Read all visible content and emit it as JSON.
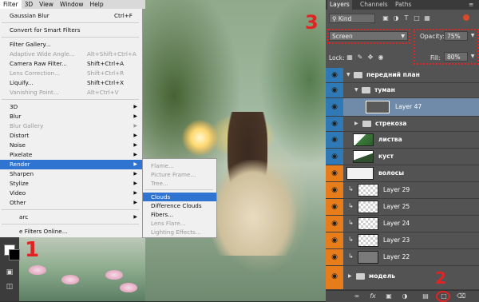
{
  "menubar": {
    "items": [
      "Filter",
      "3D",
      "View",
      "Window",
      "Help"
    ]
  },
  "filter_menu": {
    "last_filter": {
      "label": "Gaussian Blur",
      "shortcut": "Ctrl+F"
    },
    "convert": "Convert for Smart Filters",
    "special": [
      {
        "label": "Filter Gallery...",
        "shortcut": "",
        "disabled": false
      },
      {
        "label": "Adaptive Wide Angle...",
        "shortcut": "Alt+Shift+Ctrl+A",
        "disabled": true
      },
      {
        "label": "Camera Raw Filter...",
        "shortcut": "Shift+Ctrl+A",
        "disabled": false
      },
      {
        "label": "Lens Correction...",
        "shortcut": "Shift+Ctrl+R",
        "disabled": true
      },
      {
        "label": "Liquify...",
        "shortcut": "Shift+Ctrl+X",
        "disabled": false
      },
      {
        "label": "Vanishing Point...",
        "shortcut": "Alt+Ctrl+V",
        "disabled": true
      }
    ],
    "groups": [
      "3D",
      "Blur",
      "Blur Gallery",
      "Distort",
      "Noise",
      "Pixelate",
      "Render",
      "Sharpen",
      "Stylize",
      "Video",
      "Other"
    ],
    "disabled_groups": [
      "Blur Gallery"
    ],
    "highlighted": "Render",
    "digimarc_fragment": "arc",
    "browse_fragment": "e Filters Online..."
  },
  "render_submenu": {
    "items": [
      "Flame...",
      "Picture Frame...",
      "Tree...",
      "Clouds",
      "Difference Clouds",
      "Fibers...",
      "Lens Flare...",
      "Lighting Effects..."
    ],
    "disabled": [
      "Flame...",
      "Picture Frame...",
      "Tree...",
      "Lens Flare...",
      "Lighting Effects..."
    ],
    "highlighted": "Clouds"
  },
  "annotations": {
    "one": "1",
    "two": "2",
    "three": "3"
  },
  "layers_panel": {
    "tabs": [
      "Layers",
      "Channels",
      "Paths"
    ],
    "active_tab": "Layers",
    "filter_kind": "Kind",
    "blend_mode": "Screen",
    "opacity_label": "Opacity:",
    "opacity_value": "75%",
    "lock_label": "Lock:",
    "fill_label": "Fill:",
    "fill_value": "80%",
    "layers": [
      {
        "name": "передний план",
        "kind": "group",
        "bold": true
      },
      {
        "name": "туман",
        "kind": "group",
        "bold": true
      },
      {
        "name": "Layer 47",
        "kind": "layer",
        "bold": false,
        "selected": true
      },
      {
        "name": "стрекоза",
        "kind": "group",
        "bold": true
      },
      {
        "name": "листва",
        "kind": "layer",
        "bold": true
      },
      {
        "name": "куст",
        "kind": "layer",
        "bold": true
      },
      {
        "name": "волосы",
        "kind": "layer",
        "bold": true
      },
      {
        "name": "Layer 29",
        "kind": "layer",
        "bold": false
      },
      {
        "name": "Layer 25",
        "kind": "layer",
        "bold": false
      },
      {
        "name": "Layer 24",
        "kind": "layer",
        "bold": false
      },
      {
        "name": "Layer 23",
        "kind": "layer",
        "bold": false
      },
      {
        "name": "Layer 22",
        "kind": "layer",
        "bold": false
      },
      {
        "name": "модель",
        "kind": "group",
        "bold": true
      }
    ],
    "footer_icons": [
      "link-icon",
      "fx-icon",
      "mask-icon",
      "adjustment-icon",
      "folder-icon",
      "new-layer-icon",
      "trash-icon"
    ]
  },
  "colors": {
    "blue_visibility": "#2f7ab6",
    "orange_visibility": "#e77c1b",
    "highlight": "#2f74d0",
    "annotation_red": "#e02424"
  }
}
